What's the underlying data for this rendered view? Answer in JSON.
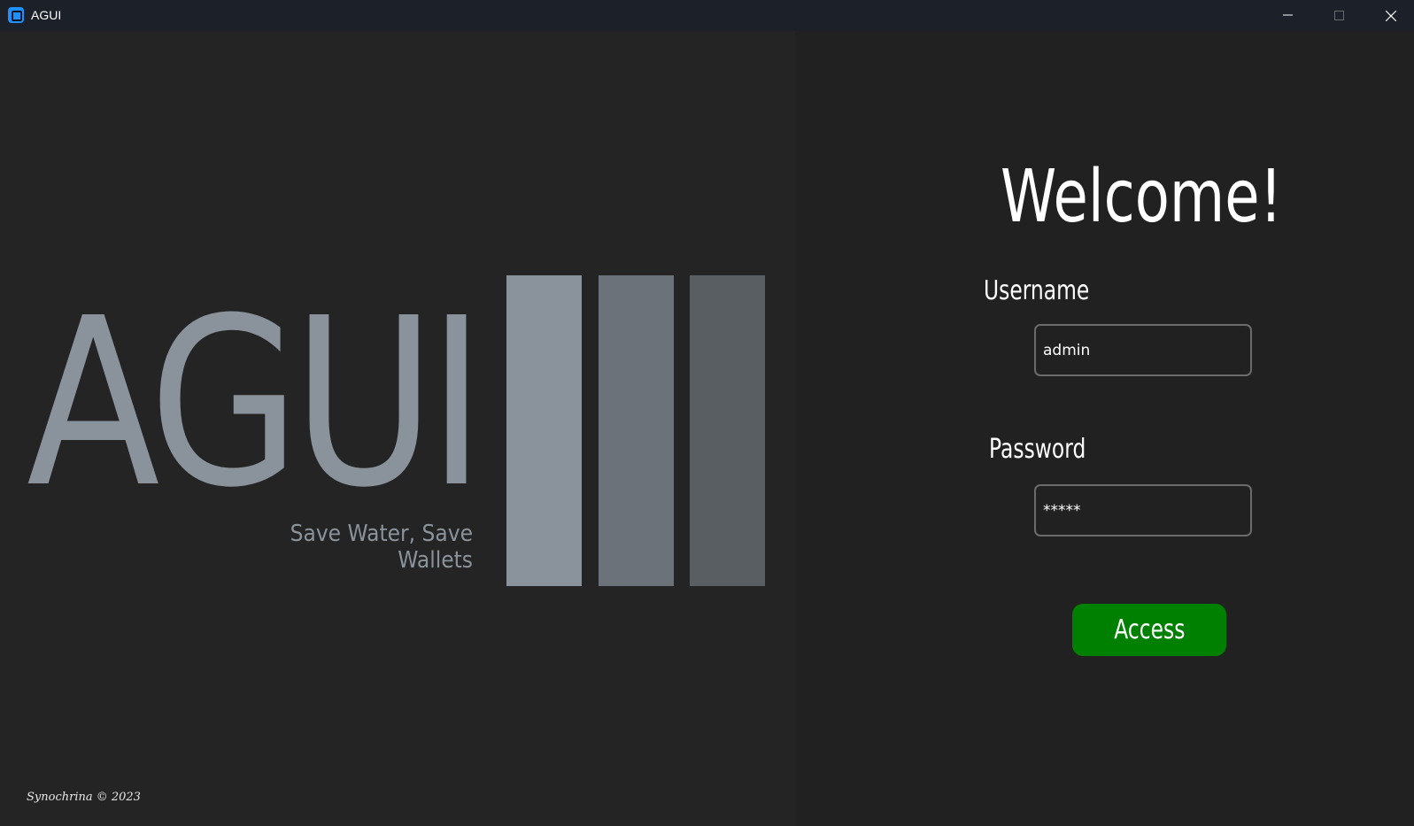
{
  "window": {
    "title": "AGUI",
    "controls": {
      "minimize": "minimize",
      "maximize": "maximize",
      "close": "close"
    }
  },
  "branding": {
    "logo_text": "AGUI",
    "tagline": "Save Water, Save Wallets",
    "copyright": "Synochrina © 2023",
    "bar_colors": [
      "#8a939c",
      "#6b727a",
      "#595e63"
    ]
  },
  "login": {
    "heading": "Welcome!",
    "username_label": "Username",
    "username_value": "admin",
    "password_label": "Password",
    "password_value": "*****",
    "access_label": "Access",
    "accent_color": "#008000"
  }
}
